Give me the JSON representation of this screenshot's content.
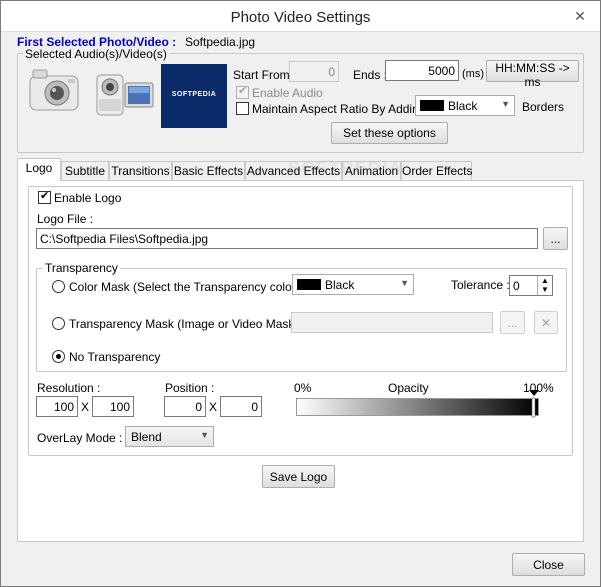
{
  "window": {
    "title": "Photo Video Settings",
    "close_glyph": "✕"
  },
  "header": {
    "first_selected_label": "First Selected Photo/Video :",
    "first_selected_value": "Softpedia.jpg",
    "selected_av_label": "Selected Audio(s)/Video(s)",
    "thumbnail_text": "SOFTPEDIA",
    "thumbnail_color": "#0a2a6a"
  },
  "options": {
    "start_from_label": "Start From :",
    "start_from_value": "0",
    "ends_label": "Ends :",
    "ends_value": "5000",
    "ms_label": "(ms)",
    "time_convert_button": "HH:MM:SS -> ms",
    "enable_audio_label": "Enable Audio",
    "maintain_aspect_label": "Maintain Aspect Ratio By Adding",
    "border_color_value": "Black",
    "borders_label": "Borders",
    "set_options_button": "Set these options"
  },
  "tabs": [
    "Logo",
    "Subtitle",
    "Transitions",
    "Basic Effects",
    "Advanced Effects",
    "Animation",
    "Order Effects"
  ],
  "watermark": "SOFTPEDIA",
  "logo": {
    "enable_logo_label": "Enable Logo",
    "logo_file_label": "Logo File :",
    "logo_file_value": "C:\\Softpedia Files\\Softpedia.jpg",
    "browse_button": "...",
    "transparency_title": "Transparency",
    "color_mask_label": "Color Mask (Select the Transparency color) :",
    "color_mask_value": "Black",
    "tolerance_label": "Tolerance :",
    "tolerance_value": "0",
    "transparency_mask_label": "Transparency Mask (Image or Video Mask) :",
    "mask_browse_button": "...",
    "mask_clear_button": "✕",
    "no_transparency_label": "No Transparency",
    "resolution_label": "Resolution :",
    "res_w": "100",
    "res_h": "100",
    "position_label": "Position :",
    "pos_x": "0",
    "pos_y": "0",
    "times": "X",
    "opacity_min": "0%",
    "opacity_label": "Opacity",
    "opacity_max": "100%",
    "opacity_value_percent": 100,
    "overlay_label": "OverLay Mode :",
    "overlay_value": "Blend",
    "save_button": "Save Logo"
  },
  "footer": {
    "close_button": "Close"
  }
}
